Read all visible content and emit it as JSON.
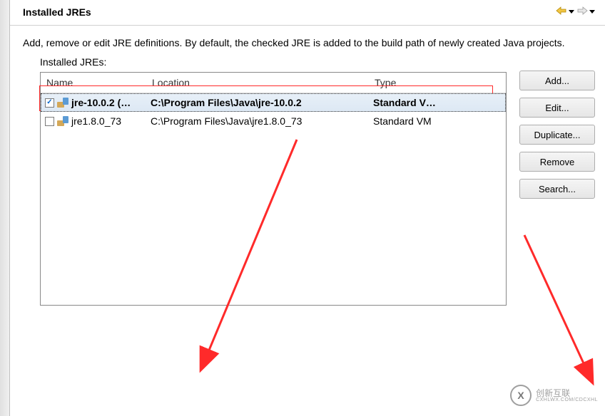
{
  "header": {
    "title": "Installed JREs"
  },
  "description": "Add, remove or edit JRE definitions. By default, the checked JRE is added to the build path of newly created Java projects.",
  "table": {
    "label": "Installed JREs:",
    "columns": {
      "name": "Name",
      "location": "Location",
      "type": "Type"
    },
    "rows": [
      {
        "checked": true,
        "selected": true,
        "name": "jre-10.0.2 (…",
        "location": "C:\\Program Files\\Java\\jre-10.0.2",
        "type": "Standard V…"
      },
      {
        "checked": false,
        "selected": false,
        "name": "jre1.8.0_73",
        "location": "C:\\Program Files\\Java\\jre1.8.0_73",
        "type": "Standard VM"
      }
    ]
  },
  "buttons": {
    "add": "Add...",
    "edit": "Edit...",
    "duplicate": "Duplicate...",
    "remove": "Remove",
    "search": "Search..."
  },
  "watermark": {
    "brand": "创新互联",
    "sub": "CXHLWX.COM/CDCXHL"
  }
}
